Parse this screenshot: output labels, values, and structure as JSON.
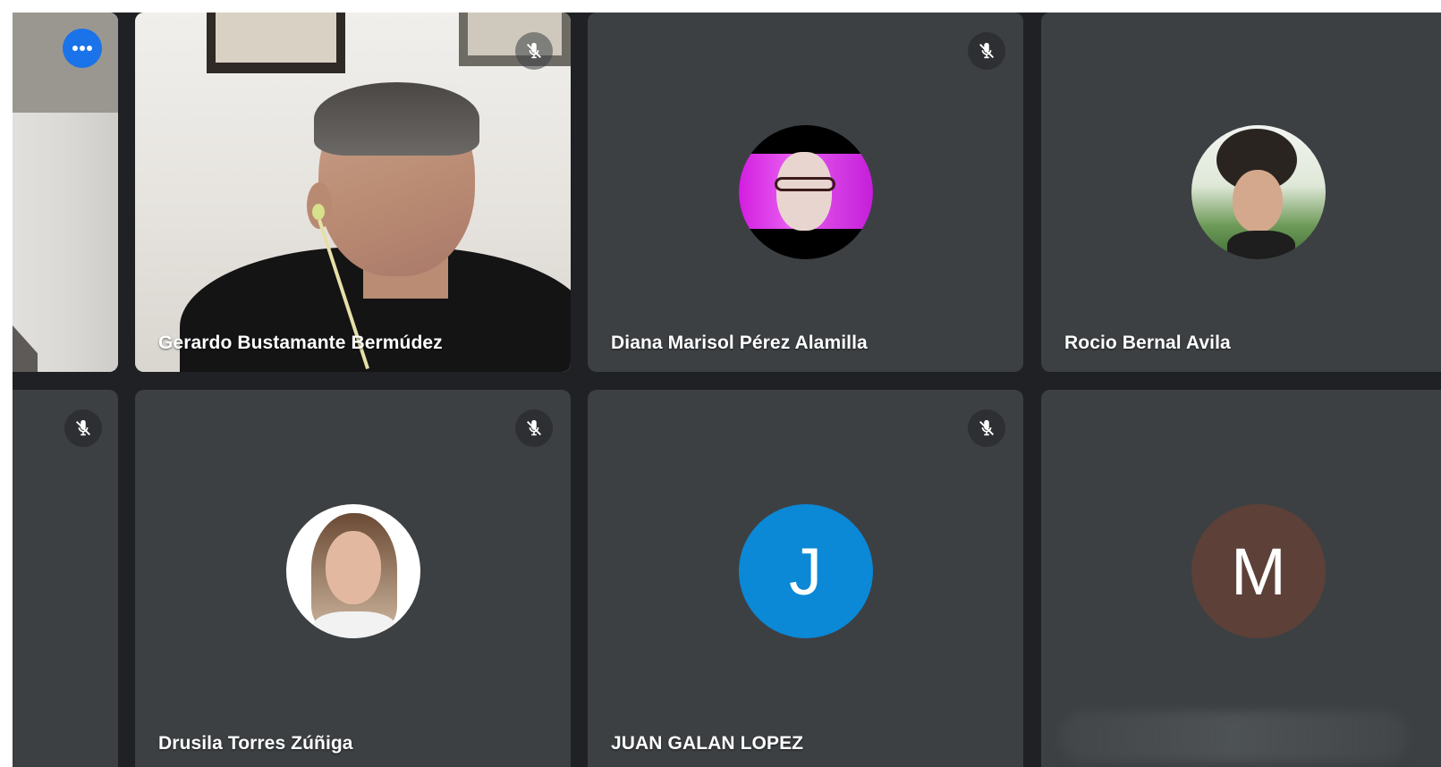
{
  "participants": [
    {
      "name": "",
      "muted": false,
      "state": "video-active"
    },
    {
      "name": "Gerardo Bustamante Bermúdez",
      "muted": true,
      "state": "video"
    },
    {
      "name": "Diana Marisol Pérez Alamilla",
      "muted": true,
      "state": "photo-avatar"
    },
    {
      "name": "Rocio Bernal Avila",
      "muted": false,
      "state": "photo-avatar"
    },
    {
      "name": "",
      "muted": true,
      "state": "empty"
    },
    {
      "name": "Drusila Torres Zúñiga",
      "muted": true,
      "state": "photo-avatar"
    },
    {
      "name": "JUAN GALAN LOPEZ",
      "muted": true,
      "state": "initial-avatar",
      "initial": "J",
      "color": "#0b88d6"
    },
    {
      "name": "",
      "muted": false,
      "state": "initial-avatar",
      "initial": "M",
      "color": "#5d4037"
    }
  ],
  "icons": {
    "mute": "mic-off-icon",
    "more": "more-options-icon"
  },
  "colors": {
    "background": "#202124",
    "tile": "#3c4043",
    "accent": "#1a73e8",
    "active_border": "#6a98f0"
  }
}
